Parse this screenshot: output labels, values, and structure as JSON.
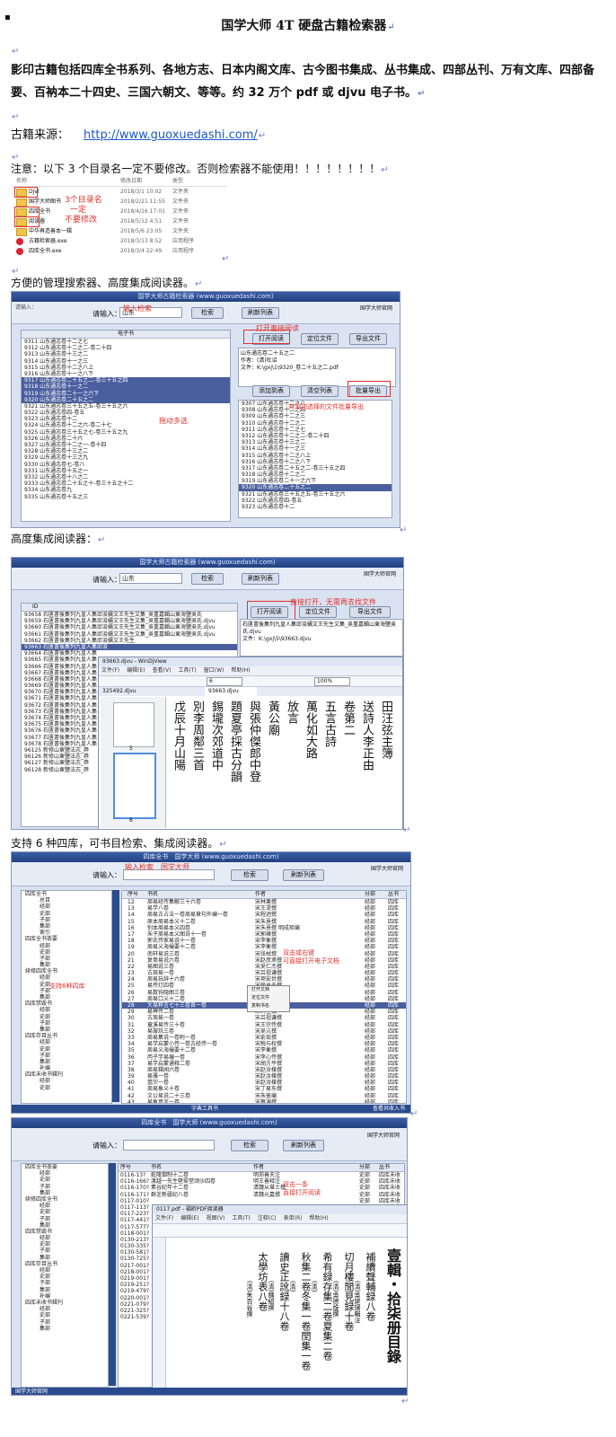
{
  "bullet": "▪",
  "title": "国学大师 4T 硬盘古籍检索器",
  "intro": "影印古籍包括四库全书系列、各地方志、日本内阁文库、古今图书集成、丛书集成、四部丛刊、万有文库、四部备要、百衲本二十四史、三国六朝文、等等。约 32 万个 pdf 或 djvu 电子书。",
  "source": {
    "label": "古籍来源：",
    "url": "http://www.guoxuedashi.com/"
  },
  "notice": "注意：以下 3 个目录名一定不要修改。否则检索器不能使用！！！！！！！！",
  "dir_listing": {
    "headers": [
      "名称",
      "修改日期",
      "类型"
    ],
    "rows": [
      {
        "name": "Djvl",
        "date": "2018/3/1 10:02",
        "type": "文件夹",
        "kind": "folder"
      },
      {
        "name": "国学大师图书",
        "date": "2018/2/21 11:55",
        "type": "文件夹",
        "kind": "folder"
      },
      {
        "name": "四库全书",
        "date": "2018/4/16 17:01",
        "type": "文件夹",
        "kind": "folder"
      },
      {
        "name": "阅读器",
        "date": "2018/5/12 4:51",
        "type": "文件夹",
        "kind": "folder"
      },
      {
        "name": "中华再造善本一辑",
        "date": "2018/5/6 23:05",
        "type": "文件夹",
        "kind": "folder"
      },
      {
        "name": "古籍检索器.exe",
        "date": "2018/3/13 8:52",
        "type": "应用程序",
        "kind": "exe"
      },
      {
        "name": "四库全书.exe",
        "date": "2018/3/4 22:49",
        "type": "应用程序",
        "kind": "exe"
      }
    ],
    "annotation": [
      "3个目录名",
      "一定",
      "不要修改"
    ]
  },
  "caption1": "方便的管理搜索器、高度集成阅读器。",
  "caption2": "高度集成阅读器：",
  "caption3": "支持 6 种四库，可书目检索、集成阅读器。",
  "app1": {
    "title": "国学大师古籍检索器 (www.guoxuedashi.com)",
    "brand": "国学大师官网",
    "search_label": "请输入：",
    "search_value": "山东",
    "search_btn": "检索",
    "refresh_btn": "刷新列表",
    "open_btn": "打开阅读",
    "locate_btn": "定位文件",
    "export_btn": "导出文件",
    "add_btn": "添加到表",
    "clear_btn": "清空列表",
    "batch_btn": "批量导出",
    "list_header": "电子书",
    "list_rows": [
      "9311  山东通志卷十二之七",
      "9312  山东通志卷十二之二-卷二十四",
      "9313  山东通志卷十三之二",
      "9314  山东通志卷十一之三",
      "9315  山东通志卷十二之八上",
      "9316  山东通志卷十一之八下",
      "9317  山东通志卷二十五之二-卷三十五之四",
      "9318  山东通志卷十一之二",
      "9319  山东通志卷二十一之六下",
      "9320  山东通志卷二十五之二",
      "9321  山东通志卷三十五之五-卷三十五之六",
      "9322  山东通志卷四-卷五",
      "9323  山东通志卷十二",
      "9324  山东通志卷十二之六-卷二十七",
      "9325  山东通志卷三十五之七-卷三十五之九",
      "9326  山东通志卷二十六",
      "9327  山东通志卷十二之一-卷十四",
      "9328  山东通志卷十三之二",
      "9329  山东通志卷十三之九",
      "9330  山东通志卷七-卷八",
      "9331  山东通志卷十五之一",
      "9332  山东通志卷十八之二",
      "9333  山东通志卷二十五之十-卷三十五之十二",
      "9334  山东通志卷九",
      "9335  山东通志卷十五之三"
    ],
    "info": [
      "山东通志卷二十五之二",
      "作者：(清)杜诏",
      "文件：K:\\gxj\\1\\9320_卷二十五之二.pdf"
    ],
    "right_rows": [
      "9307  山东通志卷十二之八",
      "9308  山东通志卷十二之四",
      "9309  山东通志卷十二之三",
      "9310  山东通志卷十二之二",
      "9311  山东通志卷十二之七",
      "9312  山东通志卷十二之二-卷二十四",
      "9313  山东通志卷十三之二",
      "9314  山东通志卷十一之三",
      "9315  山东通志卷十二之八上",
      "9316  山东通志卷十二之八下",
      "9317  山东通志卷二十五之二-卷三十五之四",
      "9318  山东通志卷十二之二",
      "9319  山东通志卷二十一之六下",
      "9320  山东通志卷二十五之二",
      "9321  山东通志卷三十五之五-卷三十五之六",
      "9322  山东通志卷四-卷五",
      "9323  山东通志卷十二"
    ],
    "notes": {
      "input": "输入检索",
      "open": "打开直接阅读",
      "multi": "拖动多选",
      "batch": "对添加选择的文件批量导出"
    }
  },
  "app2": {
    "title": "国学大师古籍检索器 (www.guoxuedashi.com)",
    "brand": "国学大师官网",
    "search_label": "请输入：",
    "search_value": "山东",
    "search_btn": "检索",
    "refresh_btn": "刷新列表",
    "open_btn": "打开阅读",
    "locate_btn": "定位文件",
    "export_btn": "导出文件",
    "note": "直接打开，无需再去找文件",
    "id_header": "ID",
    "list_rows": [
      "93658  石匱書後集列九皇人集邱浚續文王先生文集_吳重嘉輯山東海鹽吳氏",
      "93659  石匱書後集列九皇人集邱浚續文王先生文集_吳重嘉輯山東海鹽吳氏.djvu",
      "93660  石匱書後集列九皇人集邱浚續文王先生文集_吳重嘉輯山東海鹽吳氏.djvu",
      "93661  石匱書後集列九皇人集邱浚續文王先生文集_吳重嘉輯山東海鹽吳氏.djvu",
      "93662  石匱書後集列九皇人集邱浚續文王先生",
      "93663  石匱書後集列九皇人集邱浚",
      "93664  石匱書後集列九皇人集",
      "93665  石匱書後集列九皇人集",
      "93666  石匱書後集列九皇人集",
      "93667  石匱書後集列九皇人集",
      "93668  石匱書後集列九皇人集",
      "93669  石匱書後集列九皇人集",
      "93670  石匱書後集列九皇人集",
      "93671  石匱書後集列九皇人集",
      "93672  石匱書後集列九皇人集",
      "93673  石匱書後集列九皇人集",
      "93674  石匱書後集列九皇人集",
      "93675  石匱書後集列九皇人集",
      "93676  石匱書後集列九皇人集",
      "93677  石匱書後集列九皇人集",
      "93678  石匱書後集列九皇人集",
      "96125  新修山東鹽法志_莽",
      "96126  新修山東鹽法志_莽",
      "96127  新修山東鹽法志_莽",
      "96128  新修山東鹽法志_莽"
    ],
    "info": [
      "石匱書後集列九皇人集邱浚續文王先生文集_吳重嘉輯山東海鹽吳氏.djvu",
      "文件：K:\\gxj\\5\\93663.djvu"
    ],
    "viewer_title": "93663.djvu - WinDjView",
    "viewer_menu": [
      "文件(F)",
      "编辑(E)",
      "查看(V)",
      "工具(T)",
      "窗口(W)",
      "帮助(H)"
    ],
    "viewer_tab1": "325492.djvu",
    "viewer_tab2": "93663.djvu",
    "zoom": "100%",
    "page": "6",
    "page_nums": [
      "5",
      "6"
    ],
    "cols": [
      "田汪弦主簿",
      [
        "送詩人李正由"
      ],
      "卷第二",
      "五言古詩",
      "萬化如大路",
      "放言",
      "黃公廟",
      "與張仲傑郎中登",
      "題夏亭採古分韻",
      "錫壠次郊道中",
      "別李周鄰三首",
      "戊辰十月山陽"
    ]
  },
  "app3": {
    "title": "四库全书　国学大师 (www.guoxuedashi.com)",
    "brand": "国学大师官网",
    "search_label": "请输入：",
    "search_btn": "检索",
    "refresh_btn": "刷新列表",
    "note_input": "输入检索　国学大师",
    "note_right": [
      "双击或右键",
      "可直接打开电子文档"
    ],
    "note_left": "支持6种四库",
    "headers": [
      "序号",
      "书名",
      "作者",
      "分部",
      "丛书"
    ],
    "tree": [
      "四库全书",
      "总目",
      "经部",
      "史部",
      "子部",
      "集部",
      "索引",
      "四库全书荟要",
      "经部",
      "史部",
      "子部",
      "集部",
      "续修四库全书",
      "经部",
      "史部",
      "子部",
      "集部",
      "四库禁毁书",
      "经部",
      "史部",
      "子部",
      "集部",
      "四库存目丛书",
      "经部",
      "史部",
      "子部",
      "集部",
      "补编",
      "四库未收书辑刊",
      "经部",
      "史部"
    ],
    "rows": [
      [
        "12",
        "周易经传集解三十六卷",
        "宋林栗撰",
        "经部",
        "四库"
      ],
      [
        "13",
        "易学八卷",
        "宋王湜撰",
        "经部",
        "四库"
      ],
      [
        "14",
        "周易古占法一卷周易章句外编一卷",
        "宋程迥撰",
        "经部",
        "四库"
      ],
      [
        "15",
        "原本周易本义十二卷",
        "宋朱熹撰",
        "经部",
        "四库"
      ],
      [
        "16",
        "别本周易本义四卷",
        "宋朱熹撰 明成矩编",
        "经部",
        "四库"
      ],
      [
        "17",
        "朱子周易本义图说十一卷",
        "宋郭雍撰",
        "经部",
        "四库"
      ],
      [
        "18",
        "郭氏传家易说十一卷",
        "宋李衡撰",
        "经部",
        "四库"
      ],
      [
        "19",
        "周易义海撮要十二卷",
        "宋李衡撰",
        "经部",
        "四库"
      ],
      [
        "20",
        "南轩易说三卷",
        "宋张栻撰",
        "经部",
        "四库"
      ],
      [
        "21",
        "复斋易说六卷",
        "宋赵彦肃撰",
        "经部",
        "四库"
      ],
      [
        "22",
        "易图说三卷",
        "宋吴仁杰撰",
        "经部",
        "四库"
      ],
      [
        "23",
        "古周易一卷",
        "宋吕祖谦撰",
        "经部",
        "四库"
      ],
      [
        "24",
        "周易玩辞十六卷",
        "宋项安世撰",
        "经部",
        "四库"
      ],
      [
        "25",
        "易传灯四卷",
        "宋徐总干撰",
        "经部",
        "四库"
      ],
      [
        "26",
        "易数钩隐图三卷",
        "宋刘牧撰",
        "经部",
        "四库"
      ],
      [
        "27",
        "周易口义十二卷",
        "宋胡瑗撰",
        "经部",
        "四库"
      ],
      [
        "28",
        "大易粹言七十三卷首一卷",
        "宋曾穜撰",
        "经部",
        "四库"
      ],
      [
        "29",
        "易裨传二卷",
        "宋林至撰",
        "经部",
        "四库"
      ],
      [
        "30",
        "古周易一卷",
        "宋吕祖谦撰",
        "经部",
        "四库"
      ],
      [
        "31",
        "童溪易传三十卷",
        "宋王宗传撰",
        "经部",
        "四库"
      ],
      [
        "32",
        "易璇玑三卷",
        "宋吴沆撰",
        "经部",
        "四库"
      ],
      [
        "33",
        "周易集说一卷附一卷",
        "宋俞琰撰",
        "经部",
        "四库"
      ],
      [
        "34",
        "易学启蒙小传一卷古经传一卷",
        "宋税与权撰",
        "经部",
        "四库"
      ],
      [
        "35",
        "周易义海撮要十二卷",
        "宋李衡撰",
        "经部",
        "四库"
      ],
      [
        "36",
        "丙子学易编一卷",
        "宋李心传撰",
        "经部",
        "四库"
      ],
      [
        "37",
        "易学启蒙通释二卷",
        "宋胡方平撰",
        "经部",
        "四库"
      ],
      [
        "38",
        "周易辑闻六卷",
        "宋赵汝楳撰",
        "经部",
        "四库"
      ],
      [
        "39",
        "易雅一卷",
        "宋赵汝楳撰",
        "经部",
        "四库"
      ],
      [
        "40",
        "筮宗一卷",
        "宋赵汝楳撰",
        "经部",
        "四库"
      ],
      [
        "41",
        "周易象义十卷",
        "宋丁易东撰",
        "经部",
        "四库"
      ],
      [
        "42",
        "文公易说二十三卷",
        "宋朱鉴编",
        "经部",
        "四库"
      ],
      [
        "43",
        "易象意言一卷",
        "宋蔡渊撰",
        "经部",
        "四库"
      ]
    ],
    "sel_index": 16,
    "menu": [
      "打开文档",
      "定位文件",
      "复制书名"
    ],
    "status_left": "",
    "status_center": "字典工具书",
    "status_right": "查看共收入书"
  },
  "app4": {
    "title": "四库全书　国学大师 (www.guoxuedashi.com)",
    "brand": "国学大师官网",
    "search_label": "请输入：",
    "search_btn": "检索",
    "refresh_btn": "刷新列表",
    "headers": [
      "序号",
      "书名",
      "作者",
      "分部",
      "丛书"
    ],
    "tree": [
      "四库全书荟要",
      "经部",
      "史部",
      "子部",
      "集部",
      "续修四库全书",
      "经部",
      "史部",
      "子部",
      "集部",
      "四库禁毁书",
      "经部",
      "史部",
      "子部",
      "集部",
      "四库存目丛书",
      "经部",
      "史部",
      "子部",
      "集部",
      "补编",
      "四库未收书辑刊",
      "经部",
      "史部",
      "子部",
      "集部"
    ],
    "rows": [
      [
        "0116-13?",
        "乾隆御制十二卷",
        "明郑善夫注",
        "史部",
        "四库未收"
      ],
      [
        "0116-166?",
        "渡越一先生壁翠堂颂沙四卷",
        "明王善释注",
        "史部",
        "四库未收"
      ],
      [
        "0116-170?",
        "素谷纪年十二卷",
        "清魏从堪士撰",
        "史部",
        "四库未收"
      ],
      [
        "0116-171?",
        "群芝新疆纪八卷",
        "清魏元嘉撰",
        "史部",
        "四库未收"
      ],
      [
        "0117-010?",
        "",
        "",
        "史部",
        "四库未收"
      ],
      [
        "0117-113?",
        "",
        "",
        "史部",
        "四库未收"
      ],
      [
        "0117-223?",
        "",
        "",
        "史部",
        "四库未收"
      ],
      [
        "0117-441?",
        "",
        "",
        "史部",
        "四库未收"
      ],
      [
        "0117-577?",
        "",
        "",
        "史部",
        "四库未收"
      ],
      [
        "0118-001?",
        "",
        "",
        "史部",
        "四库未收"
      ],
      [
        "0130-213?",
        "",
        "",
        "史部",
        "四库未收"
      ],
      [
        "0130-335?",
        "",
        "",
        "史部",
        "四库未收"
      ],
      [
        "0130-581?",
        "",
        "",
        "史部",
        "四库未收"
      ],
      [
        "0130-725?",
        "",
        "",
        "史部",
        "四库未收"
      ],
      [
        "0217-001?",
        "",
        "",
        "史部",
        "四库未收"
      ],
      [
        "0218-001?",
        "",
        "",
        "史部",
        "四库未收"
      ],
      [
        "0219-001?",
        "",
        "",
        "史部",
        "四库未收"
      ],
      [
        "0219-251?",
        "",
        "",
        "史部",
        "四库未收"
      ],
      [
        "0219-479?",
        "",
        "",
        "史部",
        "四库未收"
      ],
      [
        "0220-001?",
        "",
        "",
        "史部",
        "四库未收"
      ],
      [
        "0221-079?",
        "",
        "",
        "史部",
        "四库未收"
      ],
      [
        "0221-325?",
        "",
        "",
        "史部",
        "四库未收"
      ],
      [
        "0221-539?",
        "",
        "",
        "史部",
        "四库未收"
      ]
    ],
    "note": [
      "双击一条",
      "直接打开阅读"
    ],
    "viewer_title": "0117.pdf - 福昕PDF阅读器",
    "viewer_menu": [
      "文件(F)",
      "编辑(E)",
      "视图(V)",
      "工具(T)",
      "注释(C)",
      "表单(R)",
      "帮助(H)"
    ],
    "cols": [
      "壹輯・拾柒册目錄",
      "補續聲輔録八卷",
      "(清)吳建瑞輯注",
      "切月樓閒見録十卷",
      "(清)吳德旋撰",
      "希有録存集二卷夏集二卷",
      "(清)",
      "秋集二卷冬集一卷閏集一卷",
      "(清)",
      "讀史正訛録十八卷",
      "(清)魏紹撰",
      "太學坊表八卷",
      "(清)朱百谷撰"
    ],
    "status_left": "国学大师官网"
  }
}
